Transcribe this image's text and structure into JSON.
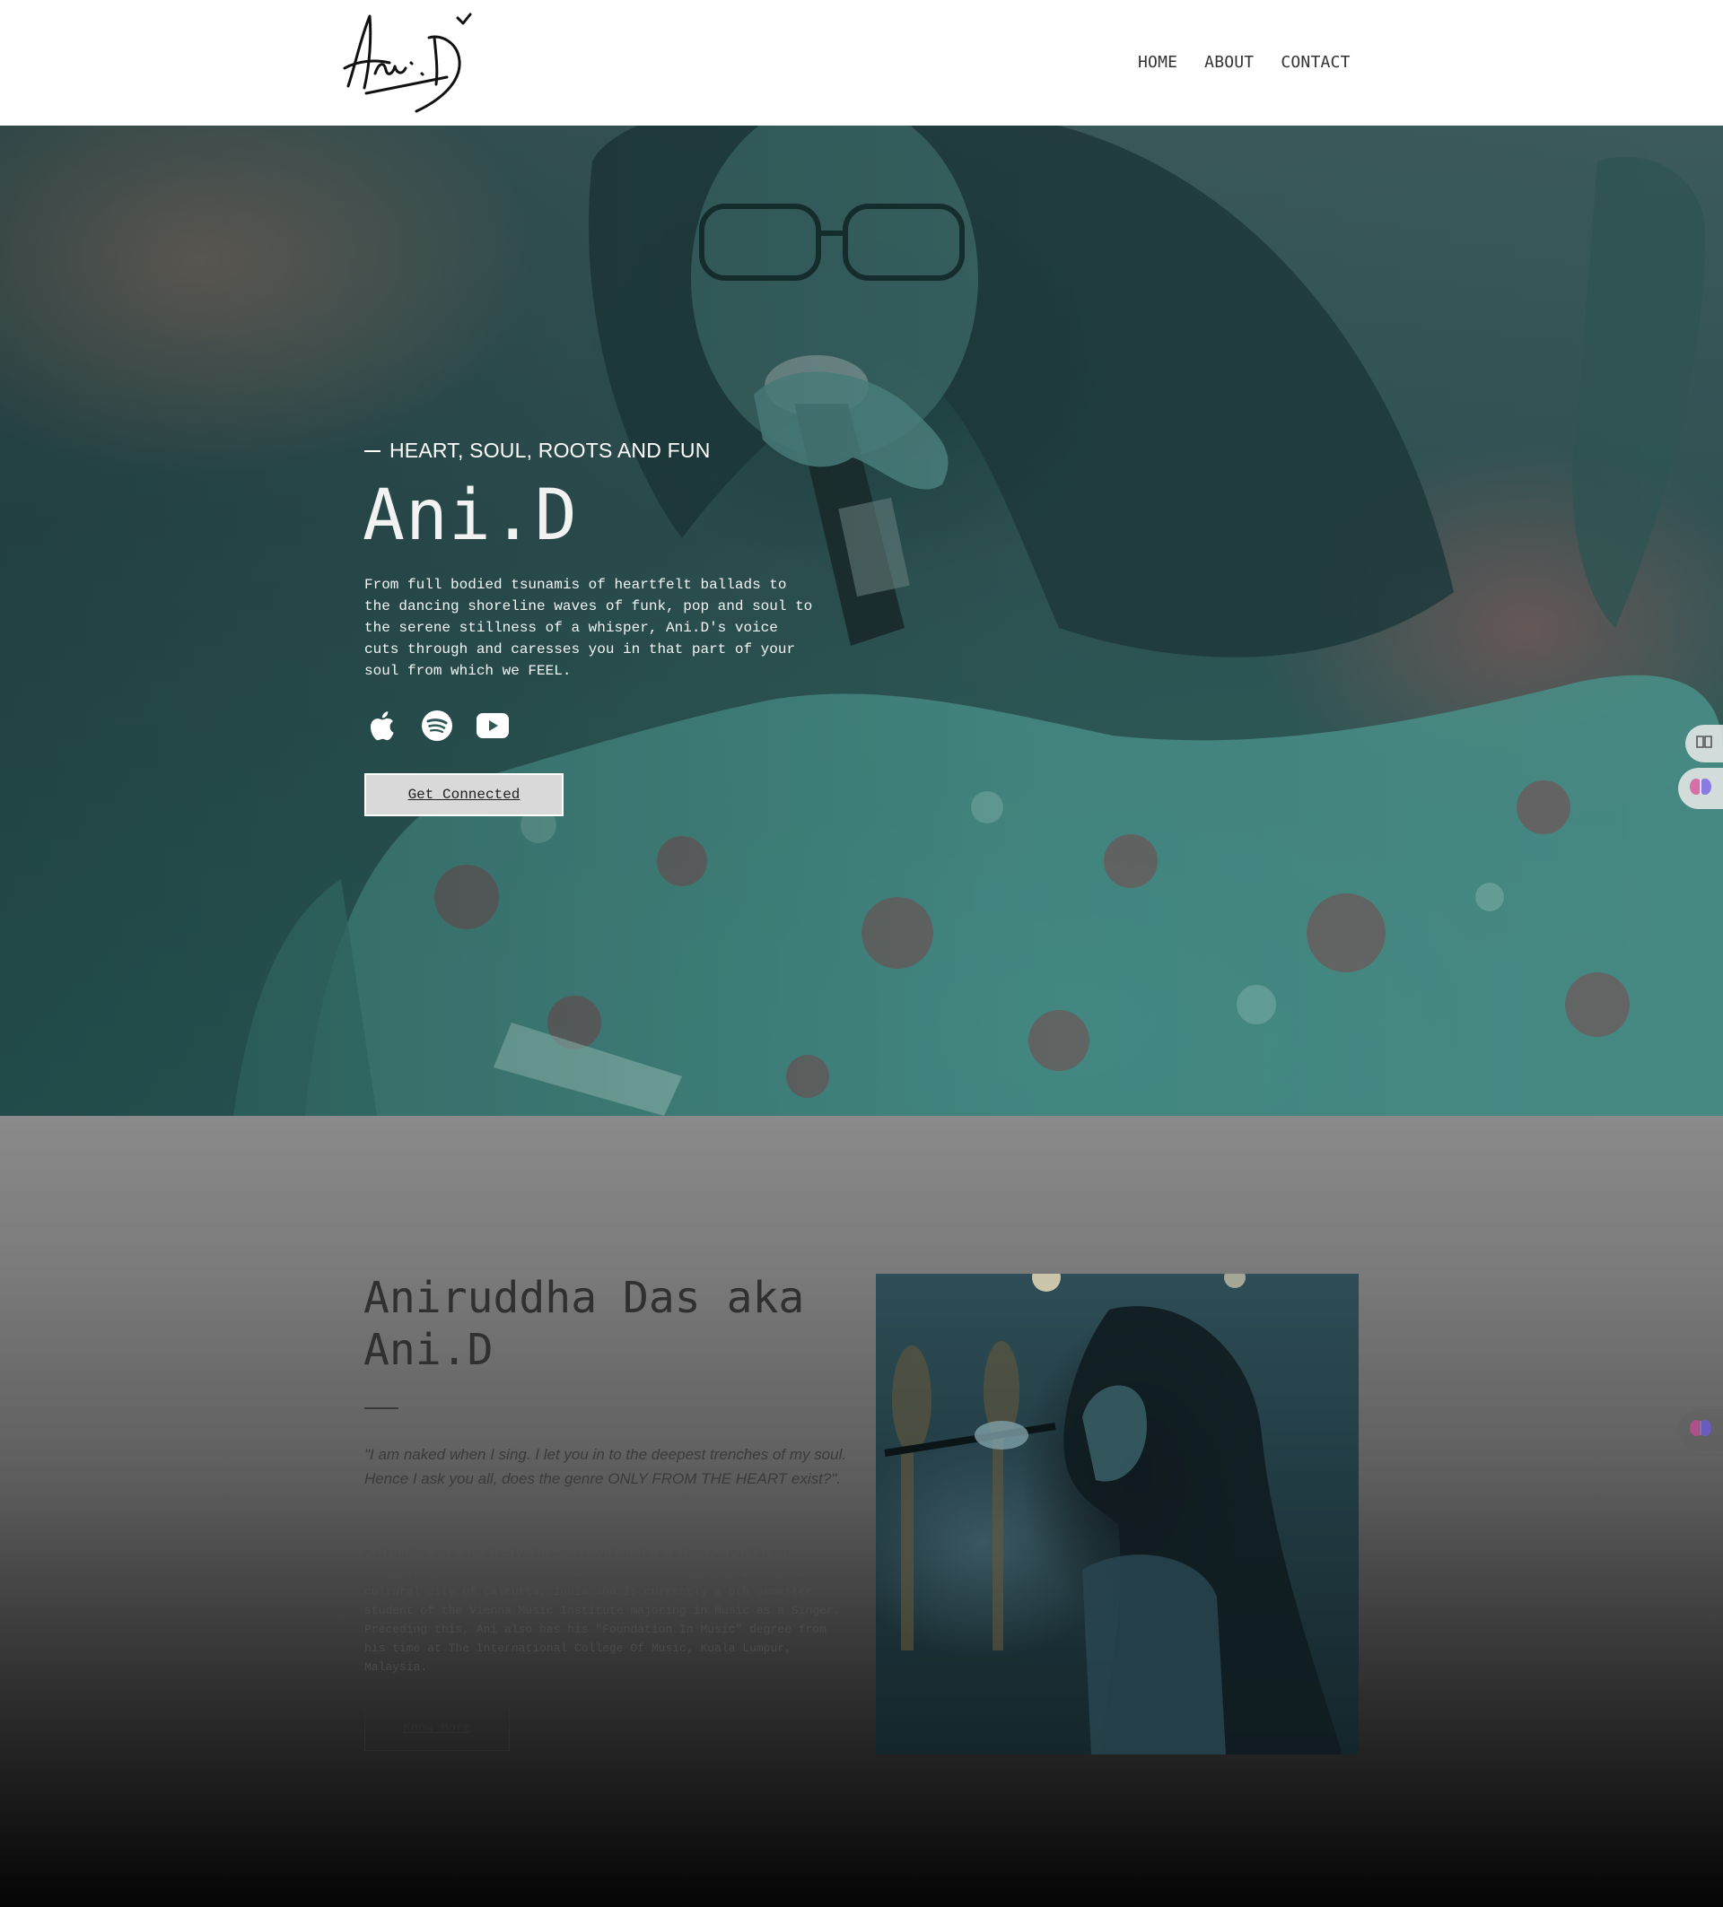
{
  "header": {
    "logo_alt": "Ani.D",
    "nav": [
      {
        "label": "HOME"
      },
      {
        "label": "ABOUT"
      },
      {
        "label": "CONTACT"
      }
    ]
  },
  "hero": {
    "eyebrow": "HEART, SOUL, ROOTS AND FUN",
    "title": "Ani.D",
    "description": "From full bodied tsunamis of heartfelt ballads to the dancing shoreline waves of funk, pop and soul to the serene stillness of a whisper, Ani.D's voice cuts through and caresses you in that part of your soul from which we FEEL.",
    "social_icons": [
      "apple-music-icon",
      "spotify-icon",
      "youtube-icon"
    ],
    "cta_label": "Get Connected"
  },
  "about": {
    "title": "Aniruddha Das aka Ani.D",
    "quote": "\"I am naked when I sing. I let you in to the deepest trenches of my soul. Hence I ask you all, does the genre ONLY FROM THE HEART exist?\".",
    "body": "Aniruddha Das or simply known as Ani.D is a Singer, Performer, Songwriter, Composer and Producer born and brought up in the rich cultural city of Calcutta, India and is currently a 6th semester student of the Vienna Music Institute majoring in Music as a Singer. Preceding this, Ani also has his \"Foundation In Music\" degree from his time at The International College Of Music, Kuala Lumpur, Malaysia.",
    "button_label": "Know More"
  },
  "colors": {
    "header_bg": "#ffffff",
    "hero_tint": "#2d5a58",
    "cta_bg": "#d9d9d9"
  }
}
